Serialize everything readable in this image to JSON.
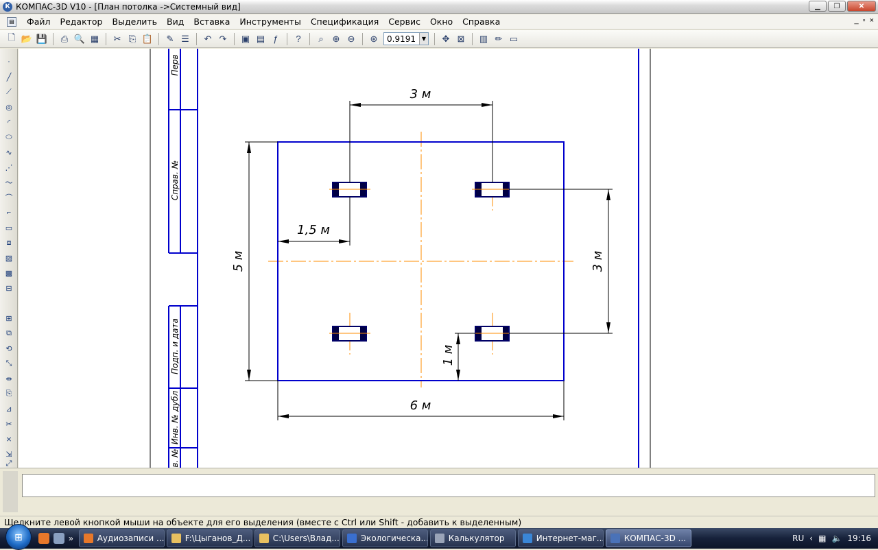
{
  "window": {
    "title": "КОМПАС-3D V10 - [План потолка ->Системный вид]",
    "app_badge": "К",
    "controls": [
      "minimize-icon",
      "maximize-icon",
      "close-icon"
    ]
  },
  "menu": {
    "items": [
      "Файл",
      "Редактор",
      "Выделить",
      "Вид",
      "Вставка",
      "Инструменты",
      "Спецификация",
      "Сервис",
      "Окно",
      "Справка"
    ],
    "doc_controls": [
      "_",
      "▫",
      "×"
    ]
  },
  "toolbar": {
    "zoom_value": "0.9191",
    "icons": [
      "new-document-icon",
      "open-icon",
      "save-icon",
      "print-icon",
      "print-preview-icon",
      "cut-icon",
      "copy-icon",
      "paste-icon",
      "properties-icon",
      "undo-icon",
      "redo-icon",
      "variables-icon",
      "manager-icon",
      "function-icon",
      "help-icon",
      "zoom-icon",
      "zoom-in-icon",
      "zoom-out-icon",
      "zoom-scale-icon",
      "pan-icon",
      "fit-icon",
      "layers-icon",
      "brush-icon",
      "panel-icon"
    ]
  },
  "left_tools": {
    "icons": [
      "point-icon",
      "line-icon",
      "segment-icon",
      "circle-icon",
      "arc-icon",
      "ellipse-icon",
      "spline-icon",
      "polyline-icon",
      "bezier-icon",
      "fillet-icon",
      "chamfer-icon",
      "rectangle-icon",
      "contour-icon",
      "hatch-icon",
      "fill-icon",
      "dim-icon",
      "edit-icon",
      "move-icon",
      "rotate-icon",
      "scale-icon",
      "mirror-icon",
      "copy-tool-icon",
      "deform-icon",
      "trim-icon",
      "break-icon",
      "stretch-icon",
      "measure-icon"
    ]
  },
  "drawing": {
    "stamp_labels": [
      "Перв",
      "Справ. №",
      "Подп. и дата",
      "Инв. № дубл",
      "в. №"
    ],
    "dimensions": {
      "top_spacing": "3 м",
      "left_offset": "1,5 м",
      "height": "5 м",
      "width": "6 м",
      "right_spacing": "3 м",
      "bottom_offset": "1 м"
    },
    "colors": {
      "outline": "#0000cc",
      "centerline": "#ff8c00",
      "dimension": "#000000"
    }
  },
  "status": {
    "hint": "Щелкните левой кнопкой мыши на объекте для его выделения (вместе с Ctrl или Shift - добавить к выделенным)"
  },
  "taskbar": {
    "tasks": [
      "Аудиозаписи ...",
      "F:\\Цыганов_Д...",
      "C:\\Users\\Влад...",
      "Экологическа...",
      "Калькулятор",
      "Интернет-маг...",
      "КОМПАС-3D ..."
    ],
    "task_colors": [
      "#e8782a",
      "#e8c060",
      "#e8c060",
      "#3a6fcf",
      "#9aa4b8",
      "#3a86d6",
      "#4a72b8"
    ],
    "language": "RU",
    "time": "19:16"
  }
}
